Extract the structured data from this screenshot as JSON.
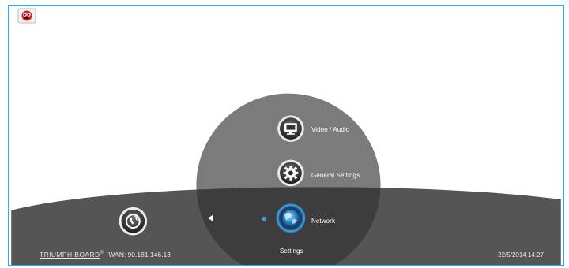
{
  "menu": {
    "items": [
      {
        "label": "Video / Audio",
        "icon": "monitor-icon"
      },
      {
        "label": "General Settings",
        "icon": "gear-icon"
      },
      {
        "label": "Network",
        "icon": "network-globe-icon"
      }
    ],
    "title": "Settings",
    "selected": "Network"
  },
  "left": {
    "call_icon": "phone-call-icon",
    "arrow_icon": "triangle-left-icon"
  },
  "footer": {
    "brand": "TRIUMPH BOARD",
    "brand_mark": "®",
    "wan": "WAN: 90.181.146.13",
    "datetime": "22/5/2014 14:27"
  },
  "colors": {
    "frame_border": "#35a7e4",
    "dark_dome": "#565656",
    "circle_light": "#7a7a7a",
    "circle_dark": "#3e3e3e",
    "selection_glow": "#2f9be0"
  }
}
